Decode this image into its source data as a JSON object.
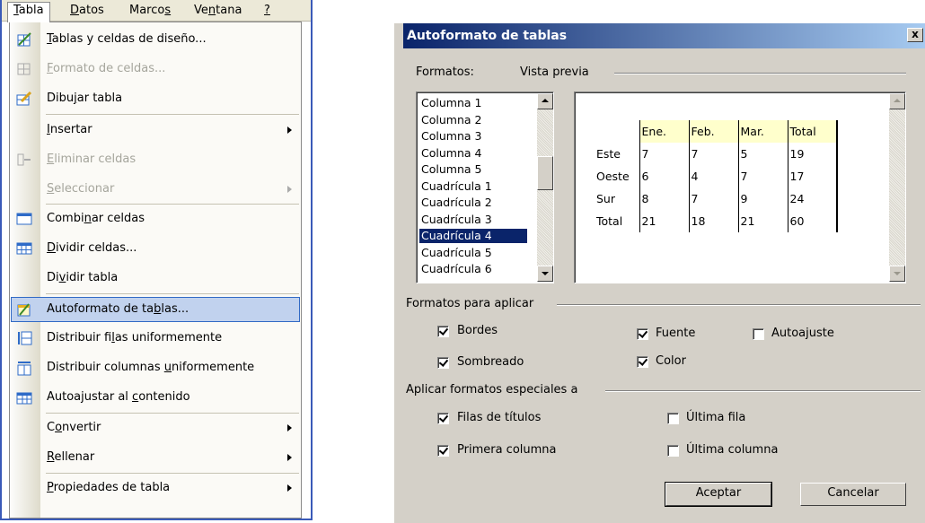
{
  "menubar": {
    "items": [
      {
        "label": "Tabla",
        "active": true
      },
      {
        "label": "Datos"
      },
      {
        "label": "Marcos"
      },
      {
        "label": "Ventana"
      },
      {
        "label": "?"
      }
    ]
  },
  "menu": {
    "items": [
      {
        "label": "Tablas y celdas de diseño...",
        "icon": "draw-table-grid-icon"
      },
      {
        "label": "Formato de celdas...",
        "icon": "cell-format-icon",
        "disabled": true
      },
      {
        "label": "Dibujar tabla",
        "icon": "pencil-table-icon"
      },
      {
        "label": "Insertar",
        "submenu": true
      },
      {
        "label": "Eliminar celdas",
        "icon": "delete-cells-icon",
        "disabled": true
      },
      {
        "label": "Seleccionar",
        "disabled": true,
        "submenu": true
      },
      {
        "label": "Combinar celdas",
        "icon": "merge-cells-icon"
      },
      {
        "label": "Dividir celdas...",
        "icon": "split-cells-icon"
      },
      {
        "label": "Dividir tabla"
      },
      {
        "label": "Autoformato de tablas...",
        "icon": "autoformat-icon",
        "highlighted": true
      },
      {
        "label": "Distribuir filas uniformemente",
        "icon": "distribute-rows-icon"
      },
      {
        "label": "Distribuir columnas uniformemente",
        "icon": "distribute-columns-icon"
      },
      {
        "label": "Autoajustar al contenido",
        "icon": "autofit-icon"
      },
      {
        "label": "Convertir",
        "submenu": true
      },
      {
        "label": "Rellenar",
        "submenu": true
      },
      {
        "label": "Propiedades de tabla",
        "submenu": true
      }
    ]
  },
  "dialog": {
    "title": "Autoformato de tablas",
    "close_label": "x",
    "formats_label": "Formatos:",
    "preview_label": "Vista previa",
    "formats": [
      "Columna 1",
      "Columna 2",
      "Columna 3",
      "Columna 4",
      "Columna 5",
      "Cuadrícula 1",
      "Cuadrícula 2",
      "Cuadrícula 3",
      "Cuadrícula 4",
      "Cuadrícula 5",
      "Cuadrícula 6"
    ],
    "selected_format": "Cuadrícula 4",
    "preview_table": {
      "header": [
        "",
        "Ene.",
        "Feb.",
        "Mar.",
        "Total"
      ],
      "rows": [
        [
          "Este",
          "7",
          "7",
          "5",
          "19"
        ],
        [
          "Oeste",
          "6",
          "4",
          "7",
          "17"
        ],
        [
          "Sur",
          "8",
          "7",
          "9",
          "24"
        ],
        [
          "Total",
          "21",
          "18",
          "21",
          "60"
        ]
      ]
    },
    "apply_group_label": "Formatos para aplicar",
    "apply": {
      "bordes": {
        "label": "Bordes",
        "checked": true
      },
      "fuente": {
        "label": "Fuente",
        "checked": true
      },
      "autoajuste": {
        "label": "Autoajuste",
        "checked": false
      },
      "sombreado": {
        "label": "Sombreado",
        "checked": true
      },
      "color": {
        "label": "Color",
        "checked": true
      }
    },
    "special_group_label": "Aplicar formatos especiales a",
    "special": {
      "filas_titulos": {
        "label": "Filas de títulos",
        "checked": true
      },
      "ultima_fila": {
        "label": "Última fila",
        "checked": false
      },
      "primera_columna": {
        "label": "Primera columna",
        "checked": true
      },
      "ultima_columna": {
        "label": "Última columna",
        "checked": false
      }
    },
    "ok_label": "Aceptar",
    "cancel_label": "Cancelar"
  }
}
